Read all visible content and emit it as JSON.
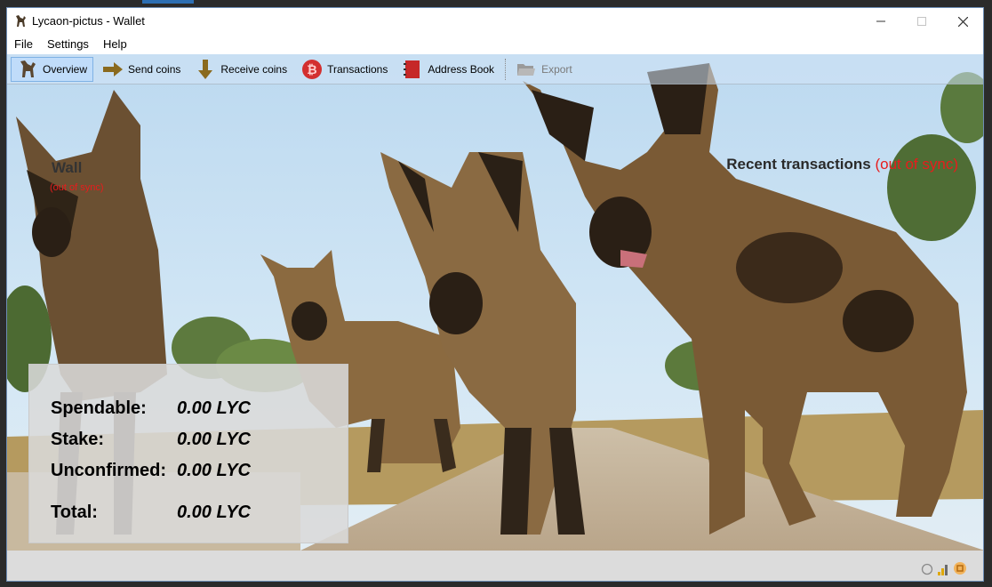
{
  "window": {
    "title": "Lycaon-pictus - Wallet",
    "controls": [
      "minimize-icon",
      "maximize-icon",
      "close-icon"
    ]
  },
  "menu": {
    "file": "File",
    "settings": "Settings",
    "help": "Help"
  },
  "toolbar": {
    "overview": "Overview",
    "send": "Send coins",
    "receive": "Receive coins",
    "transactions": "Transactions",
    "address_book": "Address Book",
    "export": "Export"
  },
  "overview": {
    "wallet_title": "Wall",
    "wallet_sync_status": "(out of sync)",
    "recent_title": "Recent transactions",
    "recent_sync_status": "(out of sync)"
  },
  "balances": {
    "spendable_label": "Spendable:",
    "spendable_value": "0.00 LYC",
    "stake_label": "Stake:",
    "stake_value": "0.00 LYC",
    "unconfirmed_label": "Unconfirmed:",
    "unconfirmed_value": "0.00 LYC",
    "total_label": "Total:",
    "total_value": "0.00 LYC"
  },
  "status": {
    "icons": [
      "sync-status-icon",
      "connections-icon",
      "staking-icon"
    ]
  },
  "colors": {
    "accent": "#e81c1c",
    "sky": "#c6dff2",
    "toolbar_active": "#bedcfa"
  }
}
